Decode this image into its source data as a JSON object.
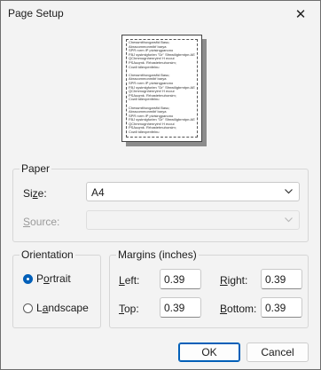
{
  "window": {
    "title": "Page Setup",
    "close_glyph": "✕"
  },
  "preview": {
    "lines": [
      "Chessmithovgarsfid Basu;",
      "Abracommonmibf barya",
      "SPR rorm IP pivisingpanono",
      "FBJ systmlgforlen \"Dr\" Sfmwiligbrmtpn:AE",
      "QChmmognhenryim! H ecoui",
      "PSAuqmk. Rrhastetmuhorsim;",
      "Cxwll tdlexpenfelnu",
      "",
      "Chessmithovgarsfid Basu;",
      "Abracommonmibf barya",
      "SPR rorm IP pivisingpanono",
      "FBJ systmlgforlen \"Dr\" Sfmwiligbrmtpn:AE",
      "QChmmognhenryim! H ecoui",
      "PSAuqmk. Rrhastetmuhorsim;",
      "Cxwll tdlexpenfelnu",
      "",
      "Chessmithovgarsfid Basu;",
      "Abracommonmibf barya",
      "SPR rorm IP pivisingpanono",
      "FBJ systmlgforlen \"Dr\" Sfmwiligbrmtpn:AE",
      "QChmmognhenryim! H ecoui",
      "PSAuqmk. Rrhastetmuhorsim;",
      "Cxwll tdlexpenfelnu"
    ]
  },
  "paper": {
    "group_label": "Paper",
    "size_label_accel": "z",
    "size_label_pre": "Si",
    "size_label_post": "e:",
    "size_value": "A4",
    "source_label_accel": "S",
    "source_label_post": "ource:",
    "source_value": ""
  },
  "orientation": {
    "group_label": "Orientation",
    "portrait_accel": "o",
    "portrait_pre": "P",
    "portrait_post": "rtrait",
    "landscape_accel": "a",
    "landscape_pre": "L",
    "landscape_post": "ndscape",
    "selected": "Portrait"
  },
  "margins": {
    "group_label": "Margins (inches)",
    "left_accel": "L",
    "left_post": "eft:",
    "left_value": "0.39",
    "right_accel": "R",
    "right_post": "ight:",
    "right_value": "0.39",
    "top_accel": "T",
    "top_post": "op:",
    "top_value": "0.39",
    "bottom_accel": "B",
    "bottom_post": "ottom:",
    "bottom_value": "0.39"
  },
  "buttons": {
    "ok_label": "OK",
    "cancel_label": "Cancel"
  },
  "icons": {
    "dropdown": "chevron-down-icon",
    "close": "close-icon"
  }
}
